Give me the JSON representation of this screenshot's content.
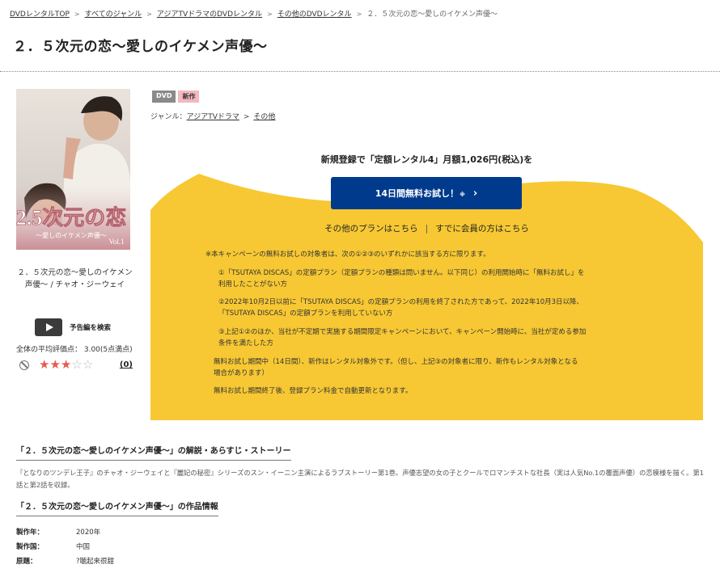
{
  "breadcrumb": {
    "items": [
      "DVDレンタルTOP",
      "すべてのジャンル",
      "アジアTVドラマのDVDレンタル",
      "その他のDVDレンタル"
    ],
    "current": "２．５次元の恋～愛しのイケメン声優～",
    "separator": ">"
  },
  "title": "２．５次元の恋～愛しのイケメン声優～",
  "cover": {
    "title_text": "2.5次元の恋",
    "subtitle_text": "〜愛しのイケメン声優〜",
    "volume": "Vol.1"
  },
  "side": {
    "title_line": "２．５次元の恋～愛しのイケメン声優～ / チャオ・ジーウェイ",
    "trailer_label": "予告編を検索",
    "avg_rating_text": "全体の平均評価点： 3.00(5点満点)",
    "rating": 3,
    "rating_max": 5,
    "review_count": "(0)"
  },
  "badges": {
    "dvd": "DVD",
    "new": "新作"
  },
  "genre": {
    "label": "ジャンル：",
    "items": [
      "アジアTVドラマ",
      "その他"
    ],
    "separator": ">"
  },
  "promo": {
    "headline": "新規登録で「定額レンタル4」月額1,026円(税込)を",
    "button_label": "14日間無料お試し！",
    "button_note": "※",
    "other_plans_link": "その他のプランはこちら",
    "members_link": "すでに会員の方はこちら",
    "divider": "|",
    "notes": {
      "intro": "※本キャンペーンの無料お試しの対象者は、次の①②③のいずれかに該当する方に限ります。",
      "item1_l1": "①「TSUTAYA DISCAS」の定額プラン（定額プランの種類は問いません。以下同じ）の利用開始時に「無料お試し」を",
      "item1_l2": "利用したことがない方",
      "item2_l1": "②2022年10月2日以前に「TSUTAYA DISCAS」の定額プランの利用を終了された方であって、2022年10月3日以降、",
      "item2_l2": "「TSUTAYA DISCAS」の定額プランを利用していない方",
      "item3_l1": "③上記①②のほか、当社が不定期で実施する期間限定キャンペーンにおいて、キャンペーン開始時に、当社が定める参加",
      "item3_l2": "条件を満たした方",
      "period_l1": "無料お試し期間中（14日間）、新作はレンタル対象外です。（但し、上記③の対象者に限り、新作もレンタル対象となる",
      "period_l2": "場合があります）",
      "after": "無料お試し期間終了後、登録プラン料金で自動更新となります。"
    }
  },
  "synopsis": {
    "heading": "「２．５次元の恋～愛しのイケメン声優～」の解説・あらすじ・ストーリー",
    "text": "『となりのツンデレ王子』のチャオ・ジーウェイと『麗妃の秘密』シリーズのスン・イーニン主演によるラブストーリー第1巻。声優志望の女の子とクールでロマンチストな社長（実は人気No.1の覆面声優）の恋模様を描く。第1話と第2話を収録。"
  },
  "work_info": {
    "heading": "「２．５次元の恋～愛しのイケメン声優～」の作品情報",
    "rows": [
      {
        "label": "製作年：",
        "value": "2020年"
      },
      {
        "label": "製作国：",
        "value": "中国"
      },
      {
        "label": "原題：",
        "value": "?聴起来很甜"
      }
    ]
  },
  "colors": {
    "promo_yellow": "#f7c833",
    "button_blue": "#003a8c",
    "star_red": "#e65a50",
    "new_badge_pink": "#f3b8c0"
  }
}
